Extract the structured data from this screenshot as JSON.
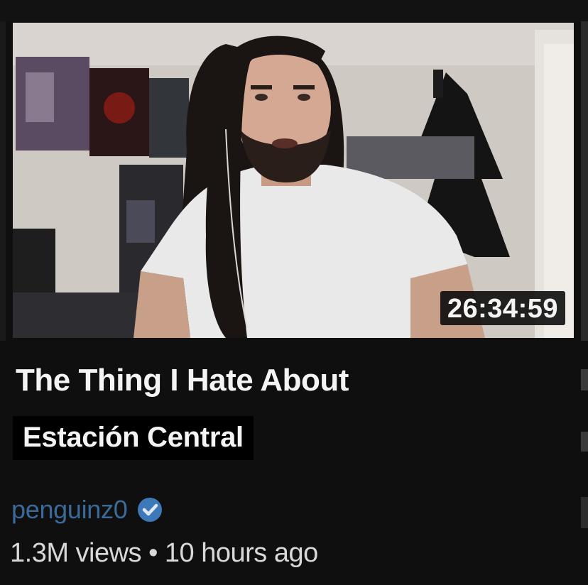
{
  "video": {
    "duration": "26:34:59",
    "title": "The Thing I Hate About",
    "caption": "Estación Central",
    "channel": "penguinz0",
    "views": "1.3M views",
    "separator": "•",
    "age": "10 hours ago"
  },
  "icons": {
    "verified": "verified-check-icon"
  },
  "colors": {
    "background": "#0f0f0f",
    "channel_text": "#3a6a9a",
    "verified_badge": "#3d78b8"
  }
}
